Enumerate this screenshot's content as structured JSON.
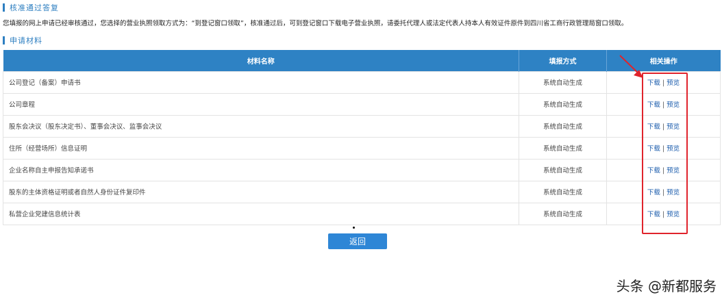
{
  "section1": {
    "title": "核准通过答复"
  },
  "notice": "您填报的网上申请已经审核通过，您选择的营业执照领取方式为：“到登记窗口领取”，核准通过后，可到登记窗口下载电子营业执照，请委托代理人或法定代表人持本人有效证件原件到四川省工商行政管理局窗口领取。",
  "section2": {
    "title": "申请材料"
  },
  "table": {
    "headers": [
      "材料名称",
      "填报方式",
      "相关操作"
    ],
    "rows": [
      {
        "name": "公司登记（备案）申请书",
        "mode": "系统自动生成",
        "download": "下载",
        "sep": "|",
        "preview": "预览"
      },
      {
        "name": "公司章程",
        "mode": "系统自动生成",
        "download": "下载",
        "sep": "|",
        "preview": "预览"
      },
      {
        "name": "股东会决议（股东决定书）、董事会决议、监事会决议",
        "mode": "系统自动生成",
        "download": "下载",
        "sep": "|",
        "preview": "预览"
      },
      {
        "name": "住所（经营场所）信息证明",
        "mode": "系统自动生成",
        "download": "下载",
        "sep": "|",
        "preview": "预览"
      },
      {
        "name": "企业名称自主申报告知承诺书",
        "mode": "系统自动生成",
        "download": "下载",
        "sep": "|",
        "preview": "预览"
      },
      {
        "name": "股东的主体资格证明或者自然人身份证件复印件",
        "mode": "系统自动生成",
        "download": "下载",
        "sep": "|",
        "preview": "预览"
      },
      {
        "name": "私营企业党建信息统计表",
        "mode": "系统自动生成",
        "download": "下载",
        "sep": "|",
        "preview": "预览"
      }
    ]
  },
  "back_label": "返回",
  "watermark": "头条 @新都服务",
  "colors": {
    "accent": "#2e82c4",
    "link": "#1f5fae",
    "annotation": "#e0232b"
  }
}
